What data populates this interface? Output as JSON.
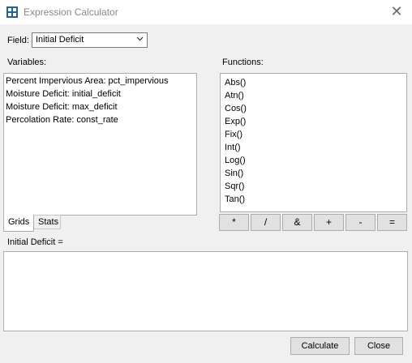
{
  "window": {
    "title": "Expression Calculator",
    "icon": "calculator-icon",
    "close_glyph": "✕"
  },
  "field": {
    "label": "Field:",
    "selected": "Initial Deficit"
  },
  "variables": {
    "label": "Variables:",
    "items": [
      "Percent Impervious Area: pct_impervious",
      "Moisture Deficit: initial_deficit",
      "Moisture Deficit: max_deficit",
      "Percolation Rate: const_rate"
    ]
  },
  "tabs": [
    {
      "label": "Grids",
      "active": true
    },
    {
      "label": "Stats",
      "active": false
    }
  ],
  "functions": {
    "label": "Functions:",
    "items": [
      "Abs()",
      "Atn()",
      "Cos()",
      "Exp()",
      "Fix()",
      "Int()",
      "Log()",
      "Sin()",
      "Sqr()",
      "Tan()"
    ]
  },
  "operators": [
    "*",
    "/",
    "&",
    "+",
    "-",
    "="
  ],
  "expression": {
    "label": "Initial Deficit =",
    "value": ""
  },
  "buttons": {
    "calculate": "Calculate",
    "close": "Close"
  },
  "colors": {
    "icon_blue": "#1f5fa8",
    "title_gray": "#8a8a8a",
    "button_face": "#e1e1e1",
    "border": "#adadad"
  }
}
